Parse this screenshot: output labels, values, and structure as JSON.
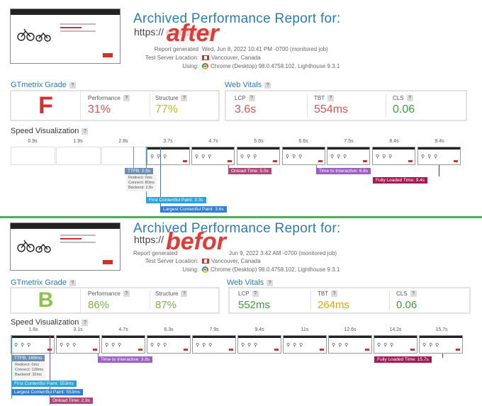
{
  "after": {
    "overlay_label": "after",
    "header": {
      "title": "Archived Performance Report for:",
      "url_prefix": "https://",
      "meta": [
        {
          "key": "Report generated",
          "value": "Wed, Jun 8, 2022 10:41 PM -0700 (monitored job)"
        },
        {
          "key": "Test Server Location:",
          "value": "Vancouver, Canada"
        },
        {
          "key": "Using:",
          "value": "Chrome (Desktop) 98.0.4758.102, Lighthouse 9.3.1"
        }
      ]
    },
    "grade": {
      "label": "GTmetrix Grade",
      "letter": "F",
      "color": "#d32f2f",
      "performance_label": "Performance",
      "performance": "31%",
      "performance_color": "#d9534f",
      "structure_label": "Structure",
      "structure": "77%",
      "structure_color": "#c8b925"
    },
    "vitals": {
      "label": "Web Vitals",
      "lcp_label": "LCP",
      "lcp": "3.6s",
      "lcp_color": "#d9534f",
      "tbt_label": "TBT",
      "tbt": "554ms",
      "tbt_color": "#d9534f",
      "cls_label": "CLS",
      "cls": "0.06",
      "cls_color": "#3aa03a"
    },
    "speed": {
      "label": "Speed Visualization",
      "ticks": [
        "0.9s",
        "1.9s",
        "2.8s",
        "3.7s",
        "4.7s",
        "5.6s",
        "6.6s",
        "7.5s",
        "8.4s",
        "9.4s"
      ],
      "markers": [
        {
          "label": "TTFB: 2.9s",
          "color": "#6c8fb5"
        },
        {
          "label": "Onload Time: 5.0s",
          "color": "#b0477c"
        },
        {
          "label": "Time to Interactive: 6.8s",
          "color": "#9c5fc4"
        },
        {
          "label": "Fully Loaded Time: 9.4s",
          "color": "#a31b55"
        },
        {
          "label": "First Contentful Paint: 3.3s",
          "color": "#29a3dd"
        },
        {
          "label": "Largest Contentful Paint: 3.6s",
          "color": "#2f7dd6"
        }
      ],
      "ttfb_details": [
        "Redirect: 0ms",
        "Connect: 80ms",
        "Backend: 2.8s"
      ]
    }
  },
  "before": {
    "overlay_label": "befor",
    "header": {
      "title": "Archived Performance Report for:",
      "url_prefix": "https://",
      "meta": [
        {
          "key": "Report generated",
          "value": "Jun 9, 2022 3:42 AM -0700 (monitored job)"
        },
        {
          "key": "Test Server Location:",
          "value": "Vancouver, Canada"
        },
        {
          "key": "Using:",
          "value": "Chrome (Desktop) 98.0.4758.102, Lighthouse 9.3.1"
        }
      ]
    },
    "grade": {
      "label": "GTmetrix Grade",
      "letter": "B",
      "color": "#8bc34a",
      "performance_label": "Performance",
      "performance": "86%",
      "performance_color": "#7cb342",
      "structure_label": "Structure",
      "structure": "87%",
      "structure_color": "#7cb342"
    },
    "vitals": {
      "label": "Web Vitals",
      "lcp_label": "LCP",
      "lcp": "552ms",
      "lcp_color": "#3aa03a",
      "tbt_label": "TBT",
      "tbt": "264ms",
      "tbt_color": "#e0a800",
      "cls_label": "CLS",
      "cls": "0.06",
      "cls_color": "#3aa03a"
    },
    "speed": {
      "label": "Speed Visualization",
      "ticks": [
        "1.6s",
        "3.1s",
        "4.7s",
        "6.3s",
        "7.9s",
        "9.4s",
        "11s",
        "12.6s",
        "14.2s",
        "15.7s"
      ],
      "markers": [
        {
          "label": "TTFB: 169ms",
          "color": "#6c8fb5"
        },
        {
          "label": "Time to Interactive: 3.8s",
          "color": "#9c5fc4"
        },
        {
          "label": "Fully Loaded Time: 15.7s",
          "color": "#a31b55"
        },
        {
          "label": "First Contentful Paint: 553ms",
          "color": "#29a3dd"
        },
        {
          "label": "Largest Contentful Paint: 553ms",
          "color": "#2f7dd6"
        },
        {
          "label": "Onload Time: 2.3s",
          "color": "#b0477c"
        }
      ],
      "ttfb_details": [
        "Redirect: 0ms",
        "Connect: 139ms",
        "Backend: 32ms"
      ]
    }
  }
}
